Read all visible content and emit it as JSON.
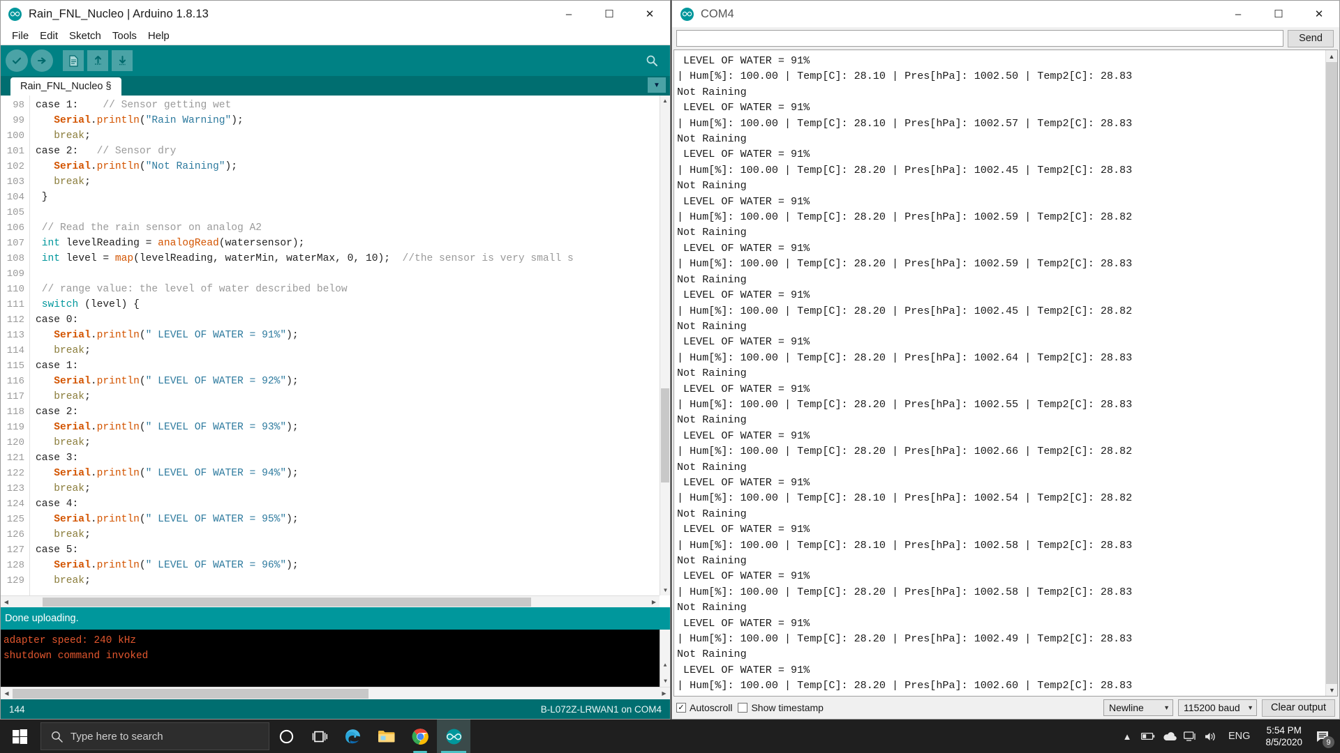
{
  "arduino": {
    "title": "Rain_FNL_Nucleo | Arduino 1.8.13",
    "icon": "arduino-infinity-icon",
    "window_buttons": {
      "minimize": "–",
      "maximize": "☐",
      "close": "✕"
    },
    "menu": [
      "File",
      "Edit",
      "Sketch",
      "Tools",
      "Help"
    ],
    "toolbar": [
      {
        "name": "verify-button",
        "glyph": "✔"
      },
      {
        "name": "upload-button",
        "glyph": "➜"
      },
      {
        "name": "new-button",
        "glyph": "὜e"
      },
      {
        "name": "open-button",
        "glyph": "↑"
      },
      {
        "name": "save-button",
        "glyph": "↓"
      },
      {
        "name": "serial-monitor-button",
        "glyph": "ὐd"
      }
    ],
    "tab_label": "Rain_FNL_Nucleo §",
    "code": [
      {
        "n": "98",
        "html": "case 1:    <span class=\"cmt\">// Sensor getting wet</span>"
      },
      {
        "n": "99",
        "html": "   <span class=\"ser\">Serial</span>.<span class=\"mth\">println</span>(<span class=\"str\">\"Rain Warning\"</span>);"
      },
      {
        "n": "100",
        "html": "   <span class=\"brk\">break</span>;"
      },
      {
        "n": "101",
        "html": "case 2:   <span class=\"cmt\">// Sensor dry</span>"
      },
      {
        "n": "102",
        "html": "   <span class=\"ser\">Serial</span>.<span class=\"mth\">println</span>(<span class=\"str\">\"Not Raining\"</span>);"
      },
      {
        "n": "103",
        "html": "   <span class=\"brk\">break</span>;"
      },
      {
        "n": "104",
        "html": " }"
      },
      {
        "n": "105",
        "html": ""
      },
      {
        "n": "106",
        "html": " <span class=\"cmt\">// Read the rain sensor on analog A2</span>"
      },
      {
        "n": "107",
        "html": " <span class=\"kw\">int</span> levelReading = <span class=\"fn\">analogRead</span>(watersensor);"
      },
      {
        "n": "108",
        "html": " <span class=\"kw\">int</span> level = <span class=\"fn\">map</span>(levelReading, waterMin, waterMax, 0, 10);  <span class=\"cmt\">//the sensor is very small s</span>"
      },
      {
        "n": "109",
        "html": ""
      },
      {
        "n": "110",
        "html": " <span class=\"cmt\">// range value: the level of water described below</span>"
      },
      {
        "n": "111",
        "html": " <span class=\"kw\">switch</span> (level) {"
      },
      {
        "n": "112",
        "html": "case 0:"
      },
      {
        "n": "113",
        "html": "   <span class=\"ser\">Serial</span>.<span class=\"mth\">println</span>(<span class=\"str\">\" LEVEL OF WATER = 91%\"</span>);"
      },
      {
        "n": "114",
        "html": "   <span class=\"brk\">break</span>;"
      },
      {
        "n": "115",
        "html": "case 1:"
      },
      {
        "n": "116",
        "html": "   <span class=\"ser\">Serial</span>.<span class=\"mth\">println</span>(<span class=\"str\">\" LEVEL OF WATER = 92%\"</span>);"
      },
      {
        "n": "117",
        "html": "   <span class=\"brk\">break</span>;"
      },
      {
        "n": "118",
        "html": "case 2:"
      },
      {
        "n": "119",
        "html": "   <span class=\"ser\">Serial</span>.<span class=\"mth\">println</span>(<span class=\"str\">\" LEVEL OF WATER = 93%\"</span>);"
      },
      {
        "n": "120",
        "html": "   <span class=\"brk\">break</span>;"
      },
      {
        "n": "121",
        "html": "case 3:"
      },
      {
        "n": "122",
        "html": "   <span class=\"ser\">Serial</span>.<span class=\"mth\">println</span>(<span class=\"str\">\" LEVEL OF WATER = 94%\"</span>);"
      },
      {
        "n": "123",
        "html": "   <span class=\"brk\">break</span>;"
      },
      {
        "n": "124",
        "html": "case 4:"
      },
      {
        "n": "125",
        "html": "   <span class=\"ser\">Serial</span>.<span class=\"mth\">println</span>(<span class=\"str\">\" LEVEL OF WATER = 95%\"</span>);"
      },
      {
        "n": "126",
        "html": "   <span class=\"brk\">break</span>;"
      },
      {
        "n": "127",
        "html": "case 5:"
      },
      {
        "n": "128",
        "html": "   <span class=\"ser\">Serial</span>.<span class=\"mth\">println</span>(<span class=\"str\">\" LEVEL OF WATER = 96%\"</span>);"
      },
      {
        "n": "129",
        "html": "   <span class=\"brk\">break</span>;"
      }
    ],
    "status_message": "Done uploading.",
    "console_lines": [
      "adapter speed: 240 kHz",
      "shutdown command invoked"
    ],
    "statusbar": {
      "line_number": "144",
      "board_port": "B-L072Z-LRWAN1 on COM4"
    },
    "colors": {
      "teal_toolbar": "#008184",
      "teal_dark": "#006e70",
      "status_teal": "#00979c",
      "console_text": "#e4572e"
    }
  },
  "serial_monitor": {
    "title": "COM4",
    "icon": "arduino-infinity-icon",
    "window_buttons": {
      "minimize": "–",
      "maximize": "☐",
      "close": "✕"
    },
    "send_input_value": "",
    "send_input_placeholder": "",
    "send_button": "Send",
    "lines": [
      " LEVEL OF WATER = 91%",
      "| Hum[%]: 100.00 | Temp[C]: 28.10 | Pres[hPa]: 1002.50 | Temp2[C]: 28.83",
      "Not Raining",
      " LEVEL OF WATER = 91%",
      "| Hum[%]: 100.00 | Temp[C]: 28.10 | Pres[hPa]: 1002.57 | Temp2[C]: 28.83",
      "Not Raining",
      " LEVEL OF WATER = 91%",
      "| Hum[%]: 100.00 | Temp[C]: 28.20 | Pres[hPa]: 1002.45 | Temp2[C]: 28.83",
      "Not Raining",
      " LEVEL OF WATER = 91%",
      "| Hum[%]: 100.00 | Temp[C]: 28.20 | Pres[hPa]: 1002.59 | Temp2[C]: 28.82",
      "Not Raining",
      " LEVEL OF WATER = 91%",
      "| Hum[%]: 100.00 | Temp[C]: 28.20 | Pres[hPa]: 1002.59 | Temp2[C]: 28.83",
      "Not Raining",
      " LEVEL OF WATER = 91%",
      "| Hum[%]: 100.00 | Temp[C]: 28.20 | Pres[hPa]: 1002.45 | Temp2[C]: 28.82",
      "Not Raining",
      " LEVEL OF WATER = 91%",
      "| Hum[%]: 100.00 | Temp[C]: 28.20 | Pres[hPa]: 1002.64 | Temp2[C]: 28.83",
      "Not Raining",
      " LEVEL OF WATER = 91%",
      "| Hum[%]: 100.00 | Temp[C]: 28.20 | Pres[hPa]: 1002.55 | Temp2[C]: 28.83",
      "Not Raining",
      " LEVEL OF WATER = 91%",
      "| Hum[%]: 100.00 | Temp[C]: 28.20 | Pres[hPa]: 1002.66 | Temp2[C]: 28.82",
      "Not Raining",
      " LEVEL OF WATER = 91%",
      "| Hum[%]: 100.00 | Temp[C]: 28.10 | Pres[hPa]: 1002.54 | Temp2[C]: 28.82",
      "Not Raining",
      " LEVEL OF WATER = 91%",
      "| Hum[%]: 100.00 | Temp[C]: 28.10 | Pres[hPa]: 1002.58 | Temp2[C]: 28.83",
      "Not Raining",
      " LEVEL OF WATER = 91%",
      "| Hum[%]: 100.00 | Temp[C]: 28.20 | Pres[hPa]: 1002.58 | Temp2[C]: 28.83",
      "Not Raining",
      " LEVEL OF WATER = 91%",
      "| Hum[%]: 100.00 | Temp[C]: 28.20 | Pres[hPa]: 1002.49 | Temp2[C]: 28.83",
      "Not Raining",
      " LEVEL OF WATER = 91%",
      "| Hum[%]: 100.00 | Temp[C]: 28.20 | Pres[hPa]: 1002.60 | Temp2[C]: 28.83"
    ],
    "autoscroll_label": "Autoscroll",
    "autoscroll_checked": "✓",
    "timestamp_label": "Show timestamp",
    "timestamp_checked": "",
    "line_ending": "Newline",
    "baud_rate": "115200 baud",
    "clear_button": "Clear output"
  },
  "taskbar": {
    "search_placeholder": "Type here to search",
    "items": [
      {
        "name": "cortana-icon",
        "label": "Cortana"
      },
      {
        "name": "task-view-icon",
        "label": "Task View"
      },
      {
        "name": "microsoft-edge-icon",
        "label": "Microsoft Edge"
      },
      {
        "name": "file-explorer-icon",
        "label": "File Explorer"
      },
      {
        "name": "google-chrome-icon",
        "label": "Google Chrome"
      },
      {
        "name": "arduino-icon",
        "label": "Arduino"
      }
    ],
    "tray": {
      "language": "ENG",
      "time": "5:54 PM",
      "date": "8/5/2020",
      "notification_count": "9"
    }
  }
}
